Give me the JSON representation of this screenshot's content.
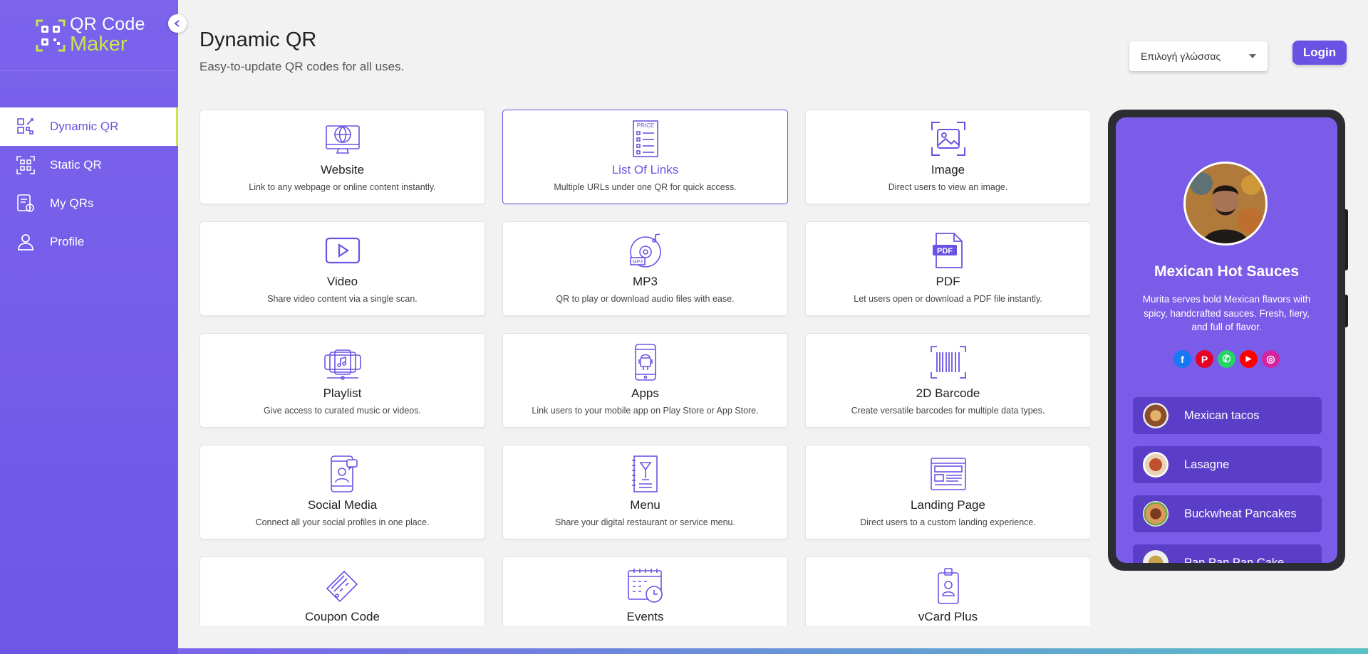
{
  "app": {
    "logo_line1": "QR Code",
    "logo_line2": "Maker"
  },
  "sidebar": {
    "items": [
      {
        "label": "Dynamic QR",
        "icon": "dynamic-qr-icon",
        "active": true
      },
      {
        "label": "Static QR",
        "icon": "static-qr-icon",
        "active": false
      },
      {
        "label": "My QRs",
        "icon": "my-qrs-icon",
        "active": false
      },
      {
        "label": "Profile",
        "icon": "profile-icon",
        "active": false
      }
    ]
  },
  "header": {
    "title": "Dynamic QR",
    "subtitle": "Easy-to-update QR codes for all uses.",
    "language_select": "Επιλογή γλώσσας",
    "login_label": "Login"
  },
  "cards": [
    {
      "name": "Website",
      "desc": "Link to any webpage or online content instantly.",
      "icon": "website-icon"
    },
    {
      "name": "List Of Links",
      "desc": "Multiple URLs under one QR for quick access.",
      "icon": "list-of-links-icon",
      "selected": true
    },
    {
      "name": "Image",
      "desc": "Direct users to view an image.",
      "icon": "image-icon"
    },
    {
      "name": "Video",
      "desc": "Share video content via a single scan.",
      "icon": "video-icon"
    },
    {
      "name": "MP3",
      "desc": "QR to play or download audio files with ease.",
      "icon": "mp3-icon"
    },
    {
      "name": "PDF",
      "desc": "Let users open or download a PDF file instantly.",
      "icon": "pdf-icon"
    },
    {
      "name": "Playlist",
      "desc": "Give access to curated music or videos.",
      "icon": "playlist-icon"
    },
    {
      "name": "Apps",
      "desc": "Link users to your mobile app on Play Store or App Store.",
      "icon": "apps-icon"
    },
    {
      "name": "2D Barcode",
      "desc": "Create versatile barcodes for multiple data types.",
      "icon": "barcode-icon"
    },
    {
      "name": "Social Media",
      "desc": "Connect all your social profiles in one place.",
      "icon": "social-media-icon"
    },
    {
      "name": "Menu",
      "desc": "Share your digital restaurant or service menu.",
      "icon": "menu-icon"
    },
    {
      "name": "Landing Page",
      "desc": "Direct users to a custom landing experience.",
      "icon": "landing-page-icon"
    },
    {
      "name": "Coupon Code",
      "desc": "",
      "icon": "coupon-icon"
    },
    {
      "name": "Events",
      "desc": "",
      "icon": "events-icon"
    },
    {
      "name": "vCard Plus",
      "desc": "",
      "icon": "vcard-icon"
    }
  ],
  "preview": {
    "title": "Mexican Hot Sauces",
    "description": "Murita serves bold Mexican flavors with spicy, handcrafted sauces. Fresh, fiery, and full of flavor.",
    "socials": [
      {
        "icon": "facebook-icon",
        "glyph": "f",
        "color": "#1877f2"
      },
      {
        "icon": "pinterest-icon",
        "glyph": "P",
        "color": "#e60023"
      },
      {
        "icon": "whatsapp-icon",
        "glyph": "✆",
        "color": "#25d366"
      },
      {
        "icon": "youtube-icon",
        "glyph": "▶",
        "color": "#ff0000"
      },
      {
        "icon": "instagram-icon",
        "glyph": "◎",
        "color": "#d6249f"
      }
    ],
    "links": [
      {
        "label": "Mexican tacos"
      },
      {
        "label": "Lasagne"
      },
      {
        "label": "Buckwheat Pancakes"
      },
      {
        "label": "Pan Pan Pan Cake"
      }
    ]
  },
  "colors": {
    "accent": "#6a53e4",
    "sidebar": "#7b63ec",
    "logo_green": "#c7e64b"
  }
}
